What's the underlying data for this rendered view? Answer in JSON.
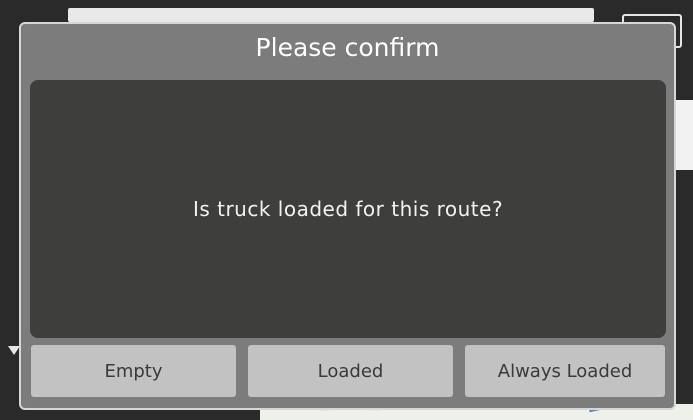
{
  "dialog": {
    "title": "Please confirm",
    "message": "Is truck loaded for this route?",
    "buttons": {
      "empty": "Empty",
      "loaded": "Loaded",
      "always_loaded": "Always Loaded"
    }
  },
  "colors": {
    "dialog_frame": "#7c7c7c",
    "dialog_body": "#3e3e3c",
    "button_bg": "#c2c2c2",
    "title_text": "#ffffff"
  }
}
